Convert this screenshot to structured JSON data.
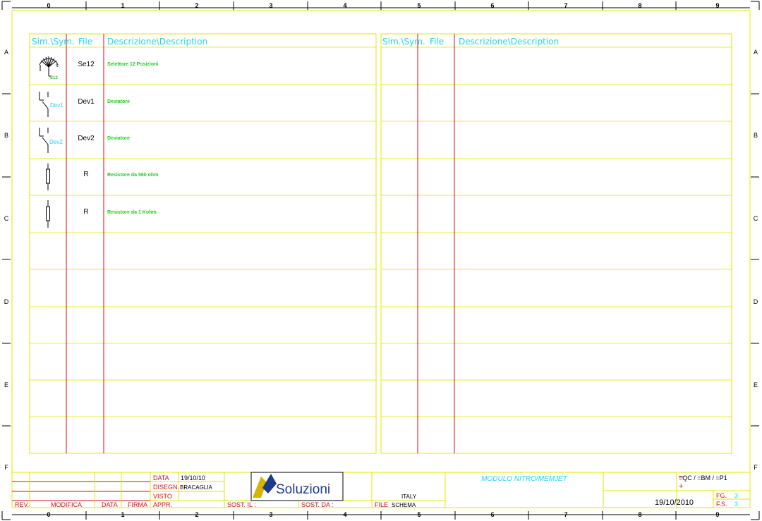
{
  "colors": {
    "frame": "#e6e600",
    "grid": "#e8e830",
    "red": "#d01010",
    "header": "#22d3ee",
    "green": "#22cc22",
    "black": "#000000",
    "blue": "#1e3a8a"
  },
  "column_numbers": [
    "0",
    "1",
    "2",
    "3",
    "4",
    "5",
    "6",
    "7",
    "8",
    "9"
  ],
  "row_letters": [
    "A",
    "B",
    "C",
    "D",
    "E",
    "F"
  ],
  "left_table": {
    "headers": {
      "sym": "Sim.\\Sym.",
      "file": "File",
      "desc": "Descrizione\\Description"
    },
    "rows": [
      {
        "symbol": "selector-12-positions",
        "symbol_label": "S12",
        "file": "Se12",
        "description": "Selettore 12 Posizioni"
      },
      {
        "symbol": "changeover-switch",
        "symbol_label": "Dev1",
        "file": "Dev1",
        "description": "Deviatore"
      },
      {
        "symbol": "changeover-switch",
        "symbol_label": "Dev2",
        "file": "Dev2",
        "description": "Deviatore"
      },
      {
        "symbol": "resistor",
        "symbol_label": "",
        "file": "R",
        "description": "Resistore da 560 ohm"
      },
      {
        "symbol": "resistor",
        "symbol_label": "",
        "file": "R",
        "description": "Resistore da 1 Kohm"
      }
    ]
  },
  "right_table": {
    "headers": {
      "sym": "Sim.\\Sym.",
      "file": "File",
      "desc": "Descrizione\\Description"
    }
  },
  "title_block": {
    "rev_label": "REV.",
    "modifica_label": "MODIFICA",
    "data_label": "DATA",
    "firma_label": "FIRMA",
    "data_field_label": "DATA",
    "data_value": "19/10/10",
    "disegn_label": "DISEGN.",
    "disegn_value": "BRACAGLIA",
    "visto_label": "VISTO",
    "appr_label": "APPR.",
    "logo_text": "Soluzioni",
    "sost_il": "SOST. IL :",
    "sost_da": "SOST. DA :",
    "country": "ITALY",
    "file_label": "FILE",
    "file_value": "SCHEMA",
    "project": "MODULO NITRO/MEMJET",
    "ref_code": "=QC / =BM / =P1",
    "plus": "+",
    "date": "19/10/2010",
    "fg_label": "FG.",
    "fg_value": "3",
    "fs_label": "F.S.",
    "fs_value": "3"
  }
}
